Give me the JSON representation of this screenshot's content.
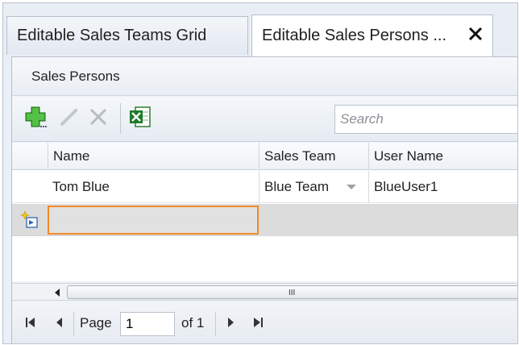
{
  "tabs": [
    {
      "label": "Editable Sales Teams Grid",
      "active": false
    },
    {
      "label": "Editable Sales Persons ...",
      "active": true
    }
  ],
  "panel": {
    "title": "Sales Persons"
  },
  "toolbar": {
    "add_icon": "add-icon",
    "edit_icon": "pencil-icon",
    "delete_icon": "delete-x-icon",
    "export_icon": "excel-export-icon",
    "search_placeholder": "Search"
  },
  "grid": {
    "columns": [
      "Name",
      "Sales Team",
      "User Name"
    ],
    "rows": [
      {
        "name": "Tom Blue",
        "sales_team": "Blue Team",
        "user_name": "BlueUser1"
      }
    ],
    "new_row_value": ""
  },
  "scrollbar": {
    "grip": "III"
  },
  "pager": {
    "page_label": "Page",
    "page_value": "1",
    "of_label": "of 1"
  },
  "colors": {
    "accent_add": "#3aa02c",
    "edit_border": "#f28a2a",
    "new_row_bg": "#dcdcdc"
  }
}
